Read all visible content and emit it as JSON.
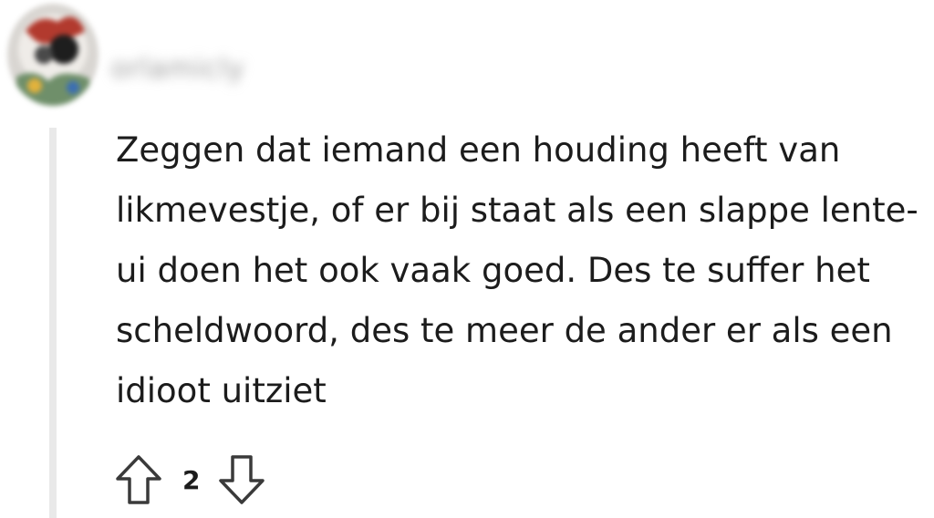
{
  "comment": {
    "username": "orlamicly",
    "body": "Zeggen dat iemand een houding heeft van likmevestje, of er bij staat als een slappe lente-ui doen het ook vaak goed. Des te suffer het scheldwoord, des te meer de ander er als een idioot uitziet",
    "score": "2",
    "icons": {
      "upvote": "arrow-up-outline",
      "downvote": "arrow-down-outline"
    },
    "colors": {
      "text": "#1c1c1c",
      "thread_line": "#e9e9e9",
      "icon_stroke": "#3a3a3a"
    }
  }
}
